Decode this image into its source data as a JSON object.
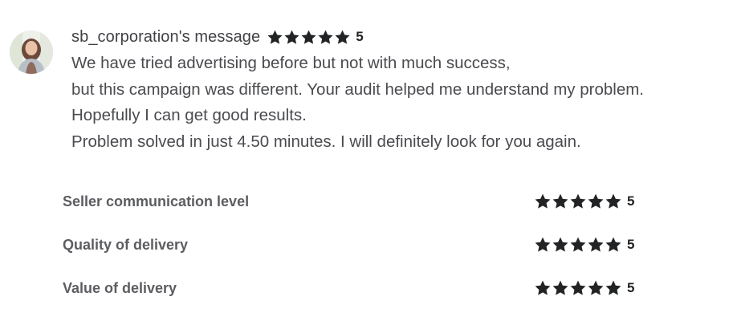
{
  "review": {
    "username_title": "sb_corporation's message",
    "rating": "5",
    "star_count": 5,
    "star_color": "#222325",
    "message_lines": [
      "We have tried advertising before but not with much success,",
      "but this campaign was different. Your audit helped me understand my problem.",
      "Hopefully I can get good results.",
      "Problem solved in just 4.50 minutes. I will definitely look for you again."
    ]
  },
  "ratings": [
    {
      "label": "Seller communication level",
      "value": "5",
      "stars": 5
    },
    {
      "label": "Quality of delivery",
      "value": "5",
      "stars": 5
    },
    {
      "label": "Value of delivery",
      "value": "5",
      "stars": 5
    }
  ],
  "icons": {
    "avatar": "user-avatar-photo",
    "star": "star-icon"
  }
}
